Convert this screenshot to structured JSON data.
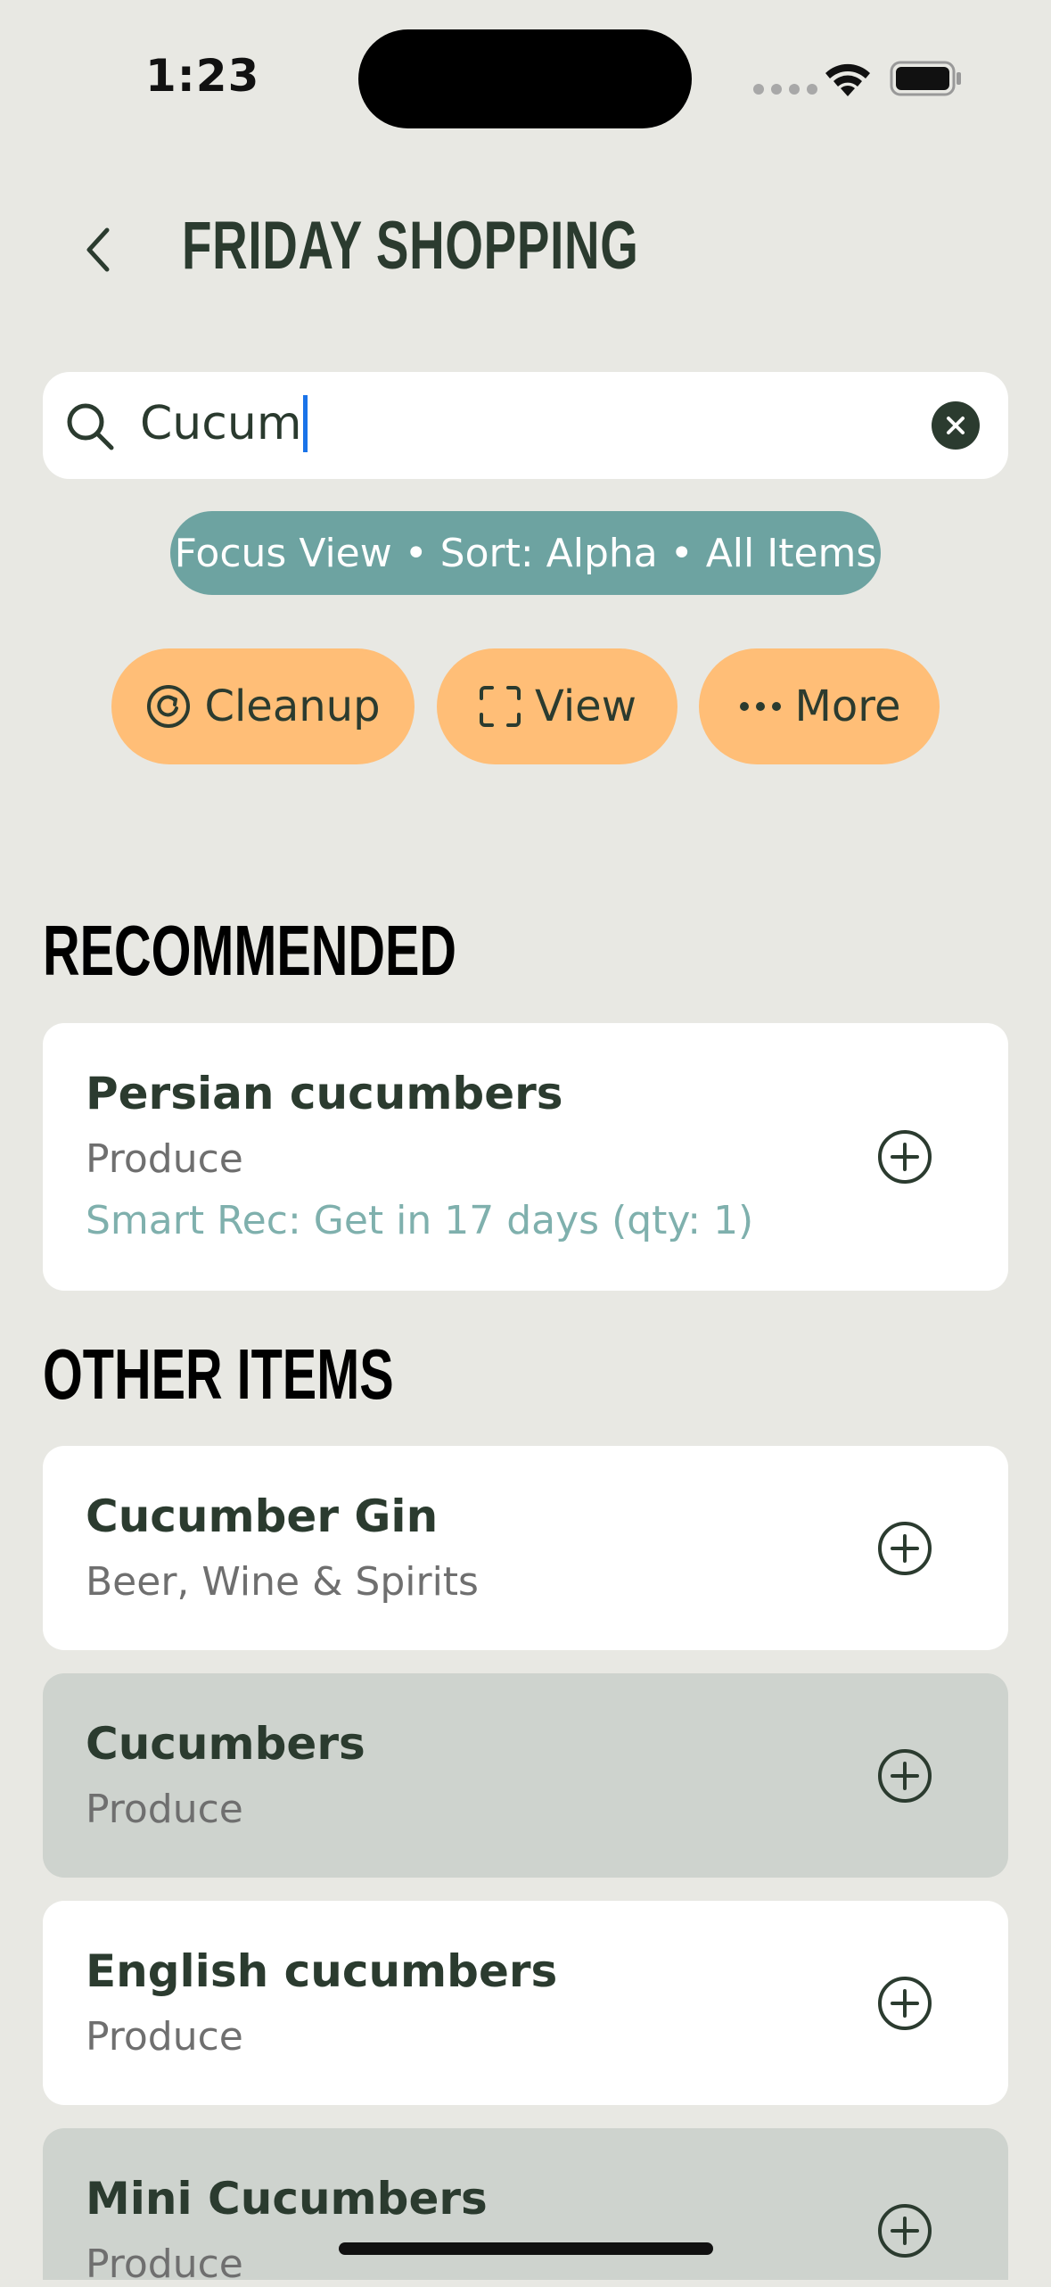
{
  "status_bar": {
    "time": "1:23"
  },
  "header": {
    "title": "FRIDAY SHOPPING"
  },
  "search": {
    "value": "Cucum"
  },
  "focus_chip": {
    "label": "Focus View • Sort: Alpha • All Items"
  },
  "actions": {
    "cleanup_label": "Cleanup",
    "view_label": "View",
    "more_label": "More"
  },
  "sections": {
    "recommended": {
      "title": "RECOMMENDED",
      "items": [
        {
          "name": "Persian cucumbers",
          "category": "Produce",
          "recommendation": "Smart Rec: Get in 17 days (qty: 1)"
        }
      ]
    },
    "other": {
      "title": "OTHER ITEMS",
      "items": [
        {
          "name": "Cucumber Gin",
          "category": "Beer, Wine & Spirits"
        },
        {
          "name": "Cucumbers",
          "category": "Produce"
        },
        {
          "name": "English cucumbers",
          "category": "Produce"
        },
        {
          "name": "Mini Cucumbers",
          "category": "Produce"
        }
      ]
    }
  },
  "colors": {
    "background": "#e8e8e3",
    "text_dark": "#2b3b2f",
    "chip_teal": "#6da3a1",
    "button_orange": "#ffbe77",
    "rec_teal": "#7fb0ad",
    "card_alt": "#ced3ce"
  }
}
